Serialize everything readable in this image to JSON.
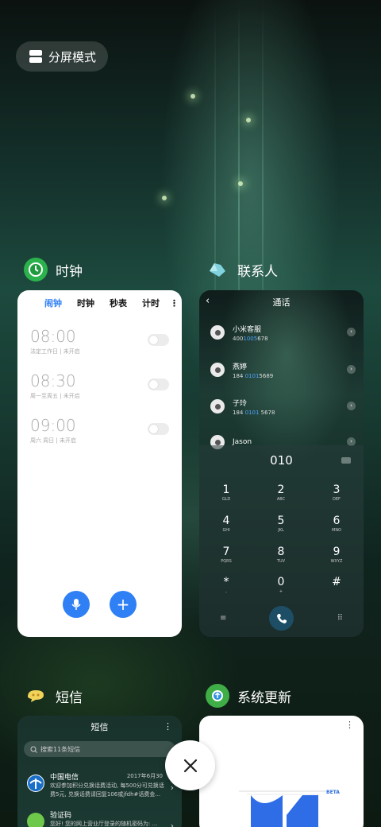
{
  "split_screen": {
    "label": "分屏模式"
  },
  "apps": {
    "clock": {
      "title": "时钟",
      "tabs": [
        "闹钟",
        "时钟",
        "秒表",
        "计时"
      ],
      "more": "⋮",
      "alarms": [
        {
          "time": "08:00",
          "sub": "法定工作日 | 未开启"
        },
        {
          "time": "08:30",
          "sub": "周一至周五 | 未开启"
        },
        {
          "time": "09:00",
          "sub": "周六 周日 | 未开启"
        }
      ],
      "add": "+"
    },
    "contacts": {
      "title": "联系人",
      "header": "通话",
      "back": "‹",
      "list": [
        {
          "name": "小米客服",
          "num_pre": "400",
          "num_hl": "1005",
          "num_post": "678"
        },
        {
          "name": "燕婷",
          "num_pre": "184 ",
          "num_hl": "0101",
          "num_post": "5689"
        },
        {
          "name": "子玲",
          "num_pre": "184 ",
          "num_hl": "0101",
          "num_post": " 5678"
        },
        {
          "name": "Jason",
          "num_pre": "",
          "num_hl": "",
          "num_post": ""
        }
      ],
      "dial_input": "010",
      "keys": [
        {
          "d": "1",
          "l": "GLD"
        },
        {
          "d": "2",
          "l": "ABC"
        },
        {
          "d": "3",
          "l": "DEF"
        },
        {
          "d": "4",
          "l": "GHI"
        },
        {
          "d": "5",
          "l": "JKL"
        },
        {
          "d": "6",
          "l": "MNO"
        },
        {
          "d": "7",
          "l": "PQRS"
        },
        {
          "d": "8",
          "l": "TUV"
        },
        {
          "d": "9",
          "l": "WXYZ"
        },
        {
          "d": "*",
          "l": ","
        },
        {
          "d": "0",
          "l": "+"
        },
        {
          "d": "#",
          "l": ""
        }
      ],
      "menu_icon": "≡",
      "grid_icon": "⠿"
    },
    "sms": {
      "title": "短信",
      "header": "短信",
      "more": "⋮",
      "search_placeholder": "搜索11条短信",
      "messages": [
        {
          "sender": "中国电信",
          "date": "2017年6月30",
          "body": "欢迎参加积分兑换话费活动, 每500分可兑换话费5元, 兑换话费请回复106或jfdh#话费金..."
        },
        {
          "sender": "验证码",
          "date": "",
          "body": "您好! 您的网上营业厅登录的随机密码为: ..."
        }
      ],
      "arrow": "›"
    },
    "update": {
      "title": "系统更新",
      "more": "⋮",
      "beta": "BETA"
    }
  },
  "close": {
    "label": "×"
  },
  "colors": {
    "accent": "#2f7ff5",
    "highlight": "#4ea3ff"
  }
}
